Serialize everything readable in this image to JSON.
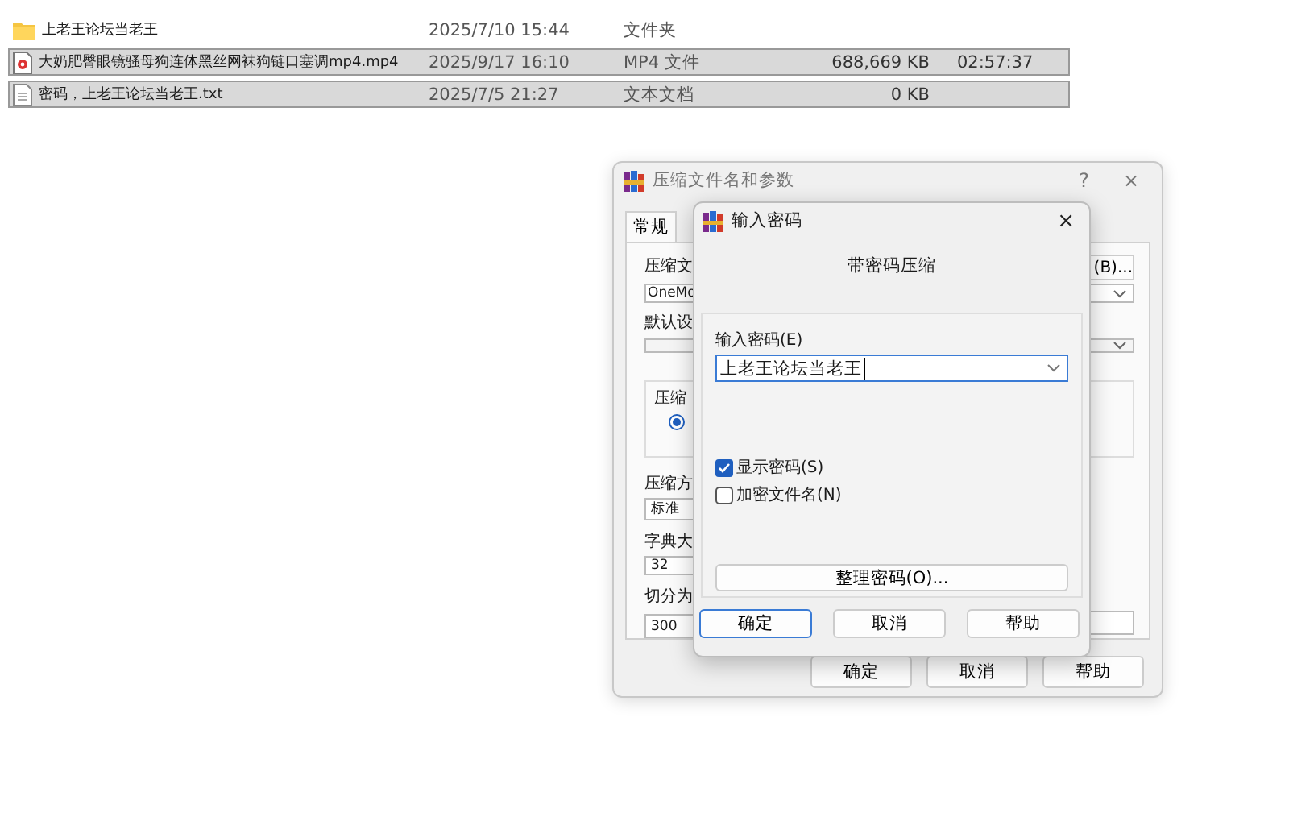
{
  "files": [
    {
      "kind": "folder",
      "name": "上老王论坛当老王",
      "date": "2025/7/10 15:44",
      "type": "文件夹",
      "selected": false
    },
    {
      "kind": "video",
      "name": "大奶肥臀眼镜骚母狗连体黑丝网袜狗链口塞调mp4.mp4",
      "date": "2025/9/17 16:10",
      "type": "MP4 文件",
      "size": "688,669 KB",
      "duration": "02:57:37",
      "selected": true
    },
    {
      "kind": "text",
      "name": "密码，上老王论坛当老王.txt",
      "date": "2025/7/5 21:27",
      "type": "文本文档",
      "size": "0 KB",
      "selected": true
    }
  ],
  "archive_dialog": {
    "title": "压缩文件名和参数",
    "help": "?",
    "close": "×",
    "tabs": [
      {
        "label": "常规",
        "selected": true
      }
    ],
    "archive_name_label": "压缩文",
    "browse_button": "(B)...",
    "archive_name": "OneMo",
    "profile_label": "默认设",
    "group_label": "压缩",
    "radio": {
      "selected": true
    },
    "method_label": "压缩方",
    "method": "标准",
    "dictionary_label": "字典大",
    "dictionary": "32",
    "split_label": "切分为",
    "split": "300",
    "buttons": [
      "确定",
      "取消",
      "帮助"
    ]
  },
  "password_dialog": {
    "title": "输入密码",
    "close": "×",
    "heading": "带密码压缩",
    "password_label": "输入密码(E)",
    "password": "上老王论坛当老王",
    "checkboxes": [
      {
        "label": "显示密码(S)",
        "checked": true
      },
      {
        "label": "加密文件名(N)",
        "checked": false
      }
    ],
    "organize_button": "整理密码(O)...",
    "buttons": [
      {
        "label": "确定",
        "selected": true
      },
      {
        "label": "取消",
        "selected": false
      },
      {
        "label": "帮助",
        "selected": false
      }
    ]
  }
}
